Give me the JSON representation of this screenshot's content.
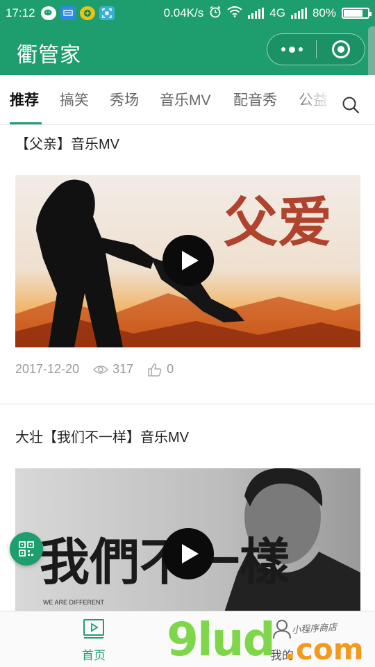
{
  "status_bar": {
    "time": "17:12",
    "speed": "0.04K/s",
    "network": "4G",
    "battery": "80%",
    "battery_level": 0.8,
    "icons": [
      "wechat-icon",
      "message-icon",
      "app-icon",
      "scan-icon",
      "alarm-icon",
      "wifi-icon",
      "signal-icon",
      "battery-icon"
    ]
  },
  "header": {
    "title": "衢管家",
    "accent_color": "#1e9e6e"
  },
  "tabs": [
    {
      "label": "推荐",
      "active": true
    },
    {
      "label": "搞笑",
      "active": false
    },
    {
      "label": "秀场",
      "active": false
    },
    {
      "label": "音乐MV",
      "active": false
    },
    {
      "label": "配音秀",
      "active": false
    },
    {
      "label": "公益",
      "active": false
    }
  ],
  "posts": [
    {
      "title": "【父亲】音乐MV",
      "thumbnail_text": "父爱",
      "date": "2017-12-20",
      "views": "317",
      "likes": "0"
    },
    {
      "title": "大壮【我们不一样】音乐MV",
      "thumbnail_text": "我們不一樣",
      "thumbnail_subtext": "WE ARE DIFFERENT"
    }
  ],
  "bottom_nav": {
    "home_label": "首页",
    "me_label": "我的"
  },
  "watermark": {
    "brand": "9lud",
    "domain": ".com",
    "tagline": "小程序商店"
  }
}
